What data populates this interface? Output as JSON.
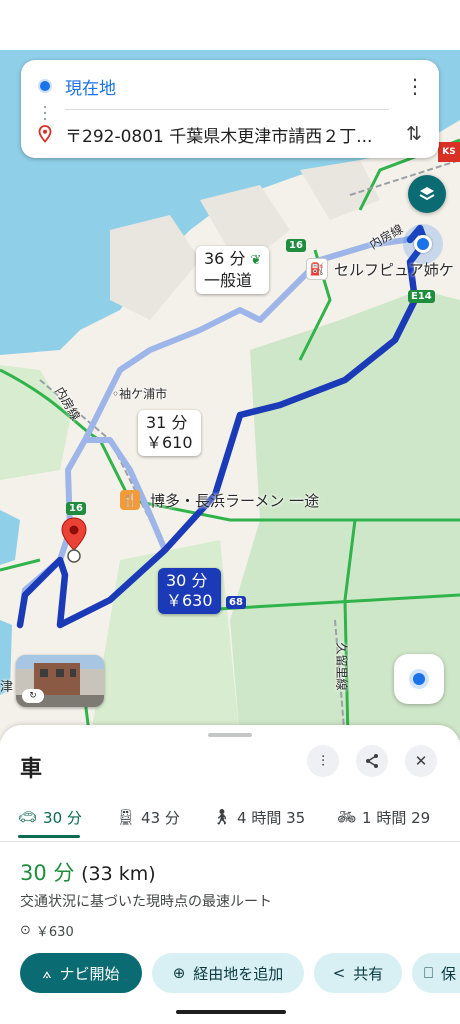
{
  "colors": {
    "route_primary": "#1a3ab8",
    "route_alt": "#9db5e8",
    "accent_green": "#1e8e3e",
    "nav_button": "#0b6b73"
  },
  "search": {
    "origin": "現在地",
    "destination": "〒292-0801 千葉県木更津市請西２丁...",
    "more_icon": "more-vert-icon",
    "swap_icon": "swap-vertical-icon"
  },
  "map": {
    "route_labels": [
      {
        "line1": "36 分",
        "line2": "一般道",
        "icon": "leaf-icon"
      },
      {
        "line1": "31 分",
        "line2": "￥610"
      },
      {
        "line1": "30 分",
        "line2": "￥630",
        "selected": true
      }
    ],
    "pois": {
      "gas_station": "セルフピュア姉ケ",
      "restaurant": "博多・長浜ラーメン 一途",
      "city": "袖ケ浦市",
      "rail_uchibo": "内房線",
      "rail_uchibo2": "内房線",
      "rail_kururi": "久留里線",
      "edge_text": "津"
    },
    "road_shields": [
      "16",
      "16",
      "E14",
      "68"
    ],
    "ks_badge": "KS"
  },
  "sheet": {
    "title": "車",
    "icons": [
      "tune-icon",
      "share-icon",
      "close-icon"
    ],
    "tabs": [
      {
        "icon": "car-icon",
        "label": "30 分",
        "active": true
      },
      {
        "icon": "train-icon",
        "label": "43 分"
      },
      {
        "icon": "walk-icon",
        "label": "4 時間 35"
      },
      {
        "icon": "bike-icon",
        "label": "1 時間 29"
      }
    ],
    "duration": "30 分",
    "distance": "(33 km)",
    "description": "交通状況に基づいた現時点の最速ルート",
    "toll": "￥630",
    "buttons": [
      {
        "icon": "navigation-icon",
        "label": "ナビ開始"
      },
      {
        "icon": "add-stop-icon",
        "label": "経由地を追加"
      },
      {
        "icon": "share-icon",
        "label": "共有"
      },
      {
        "icon": "save-icon",
        "label": "保"
      }
    ]
  }
}
